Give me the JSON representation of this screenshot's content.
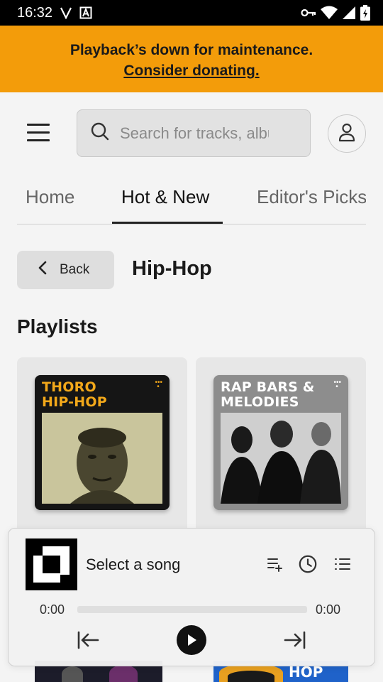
{
  "status_bar": {
    "time": "16:32"
  },
  "banner": {
    "line1": "Playback’s down for maintenance.",
    "link": "Consider donating."
  },
  "search": {
    "placeholder": "Search for tracks, albums, artists"
  },
  "tabs": [
    {
      "label": "Home"
    },
    {
      "label": "Hot & New",
      "active": true
    },
    {
      "label": "Editor's Picks"
    }
  ],
  "back_label": "Back",
  "genre_title": "Hip-Hop",
  "section_title": "Playlists",
  "playlists": [
    {
      "title_line1": "THORO",
      "title_line2": "HIP-HOP",
      "title_color": "#f2a81a"
    },
    {
      "title_line1": "RAP BARS &",
      "title_line2": "MELODIES",
      "title_color": "#ffffff"
    }
  ],
  "bottom_peek": {
    "right_text": "HOP"
  },
  "player": {
    "song": "Select a song",
    "time_elapsed": "0:00",
    "time_total": "0:00",
    "progress": 0
  }
}
